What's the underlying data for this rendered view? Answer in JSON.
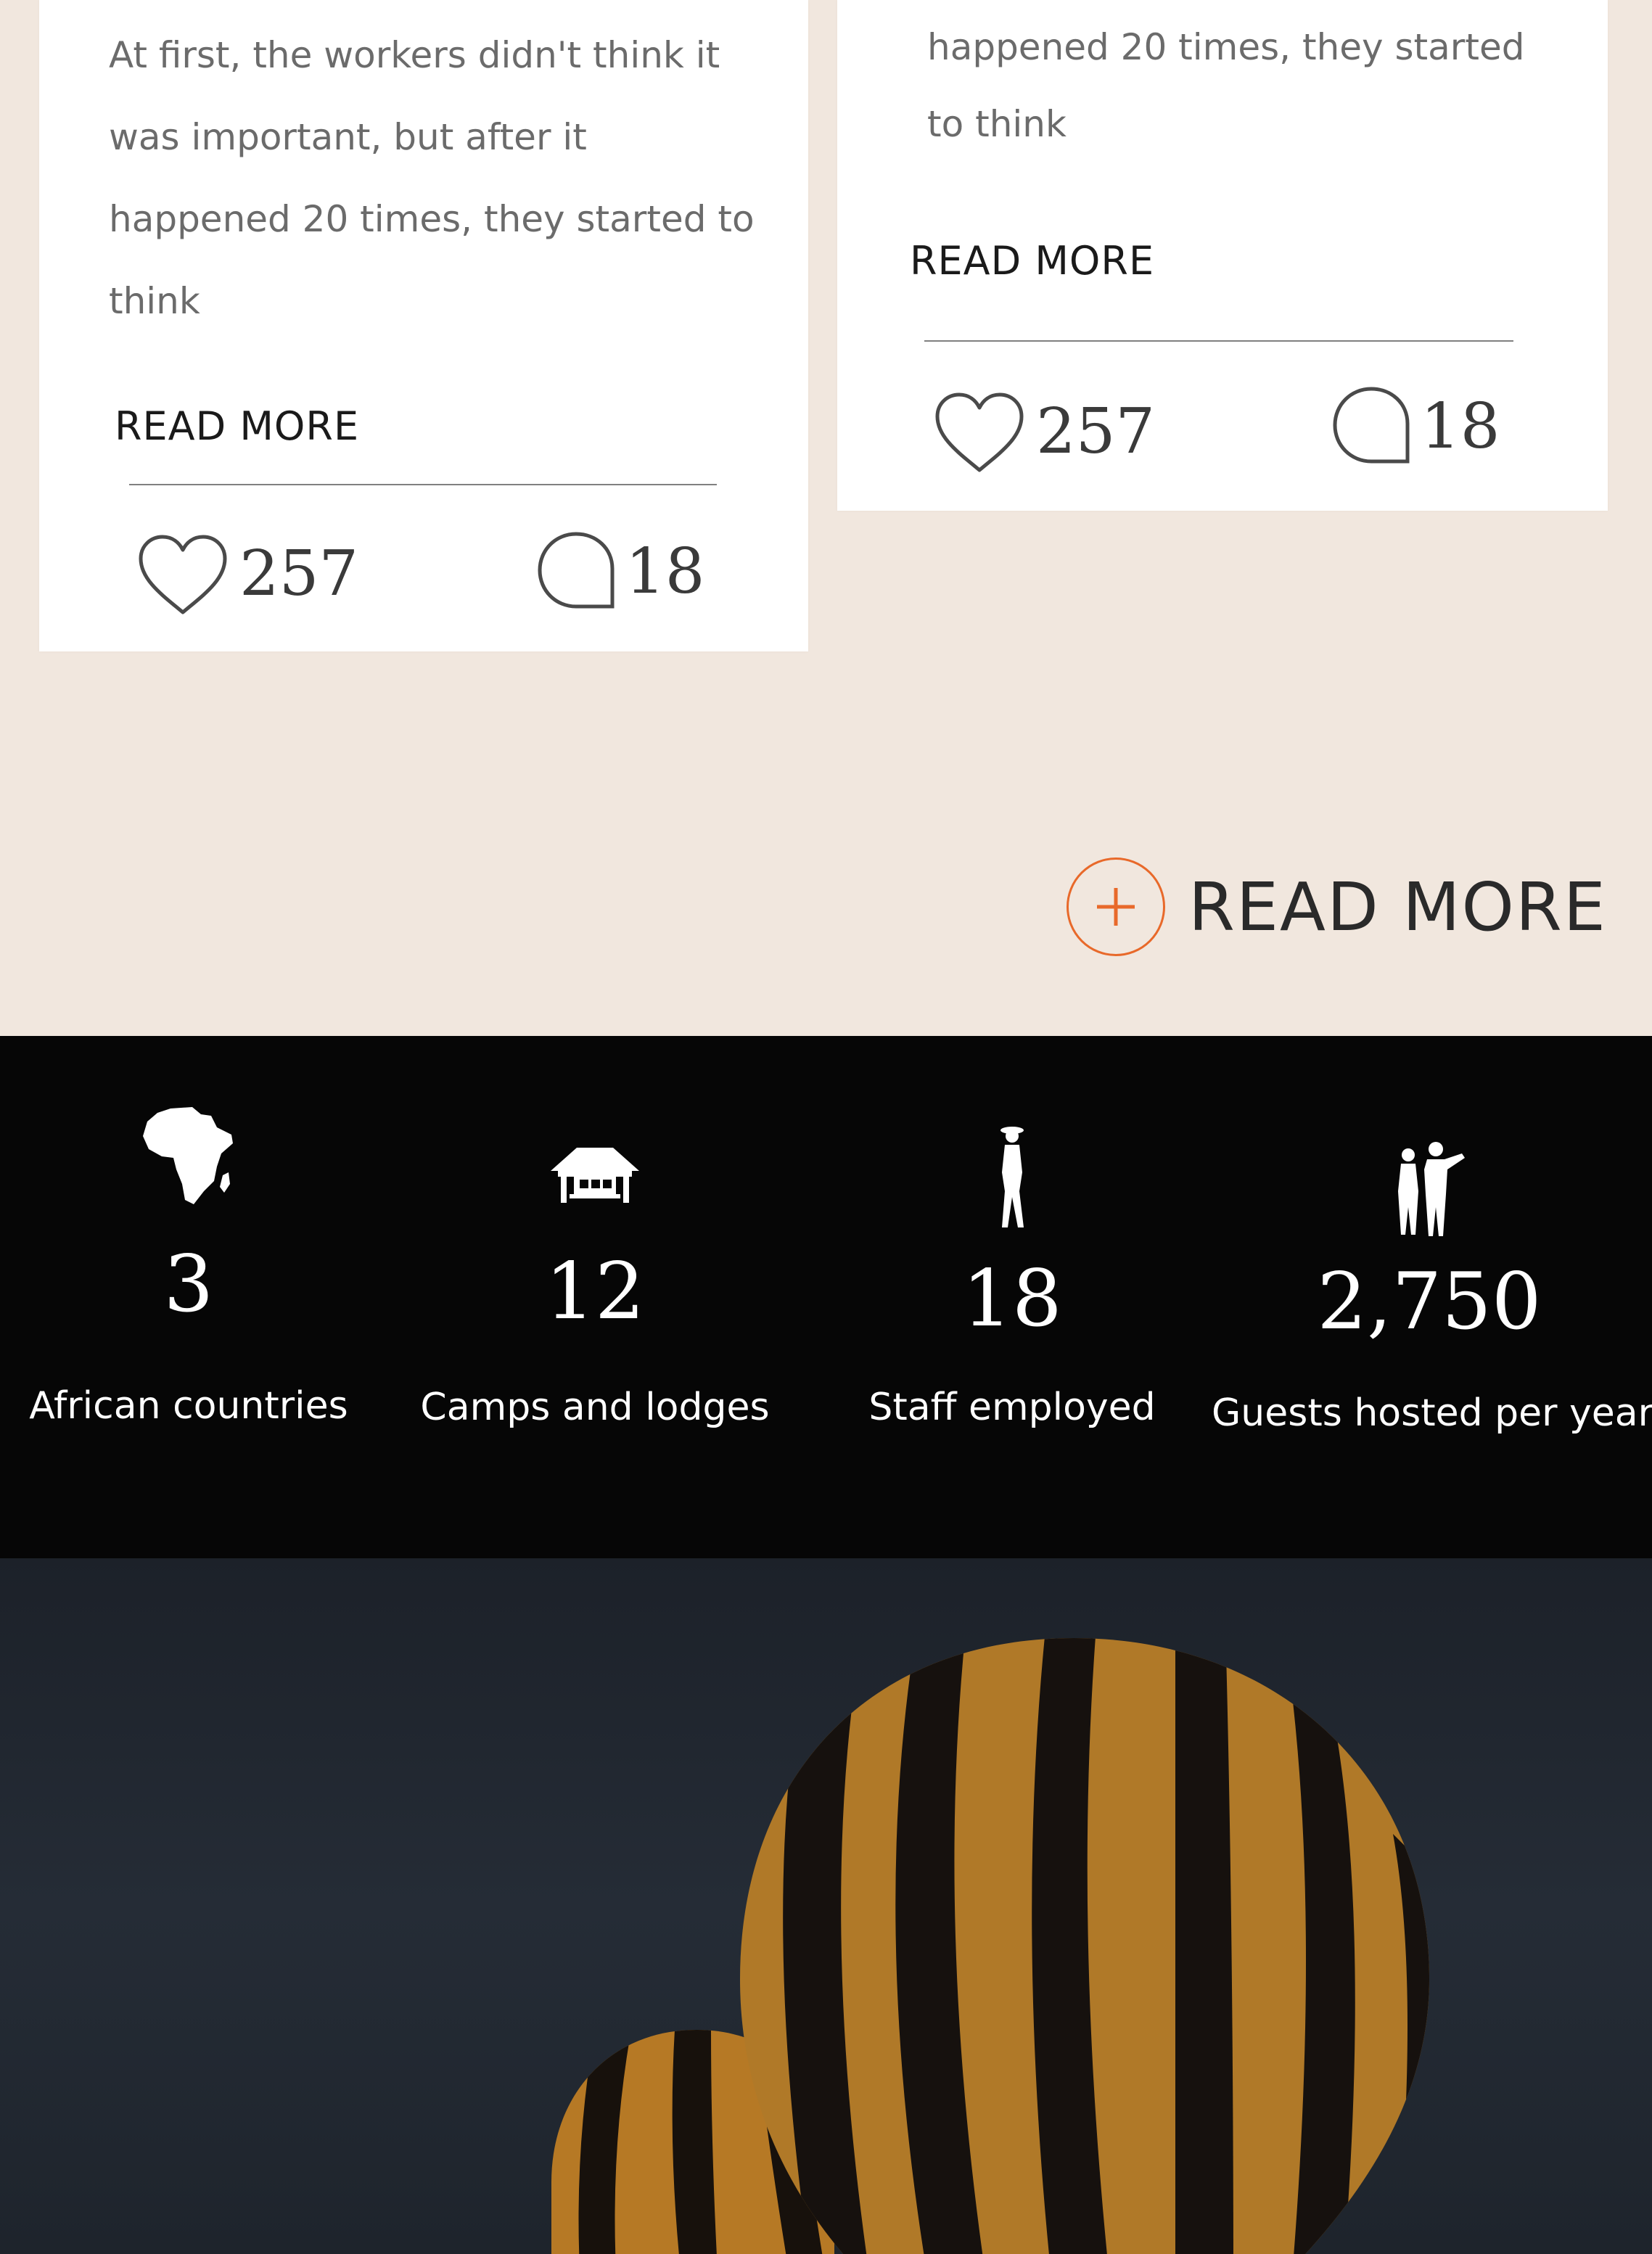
{
  "posts": [
    {
      "excerpt": "At first, the workers didn't think it was important, but after it happened 20 times, they started to think",
      "read_more": "READ MORE",
      "likes": "257",
      "comments": "18"
    },
    {
      "excerpt": "happened 20 times, they started to think",
      "read_more": "READ MORE",
      "likes": "257",
      "comments": "18"
    }
  ],
  "read_more_main": {
    "label": "READ MORE",
    "icon": "plus-circle-icon"
  },
  "stats": [
    {
      "number": "3",
      "caption": "African countries",
      "icon": "africa-map-icon"
    },
    {
      "number": "12",
      "caption": "Camps and lodges",
      "icon": "lodge-icon"
    },
    {
      "number": "18",
      "caption": "Staff employed",
      "icon": "ranger-icon"
    },
    {
      "number": "2,750",
      "caption": "Guests hosted per year",
      "icon": "guests-icon"
    }
  ],
  "colors": {
    "page_background": "#f1e7de",
    "accent": "#e8692a",
    "stats_background": "#060606",
    "balloon_orange": "#c98a2e",
    "balloon_dark": "#1a1410"
  },
  "hero": {
    "image": "hot-air-balloons-at-dusk"
  }
}
